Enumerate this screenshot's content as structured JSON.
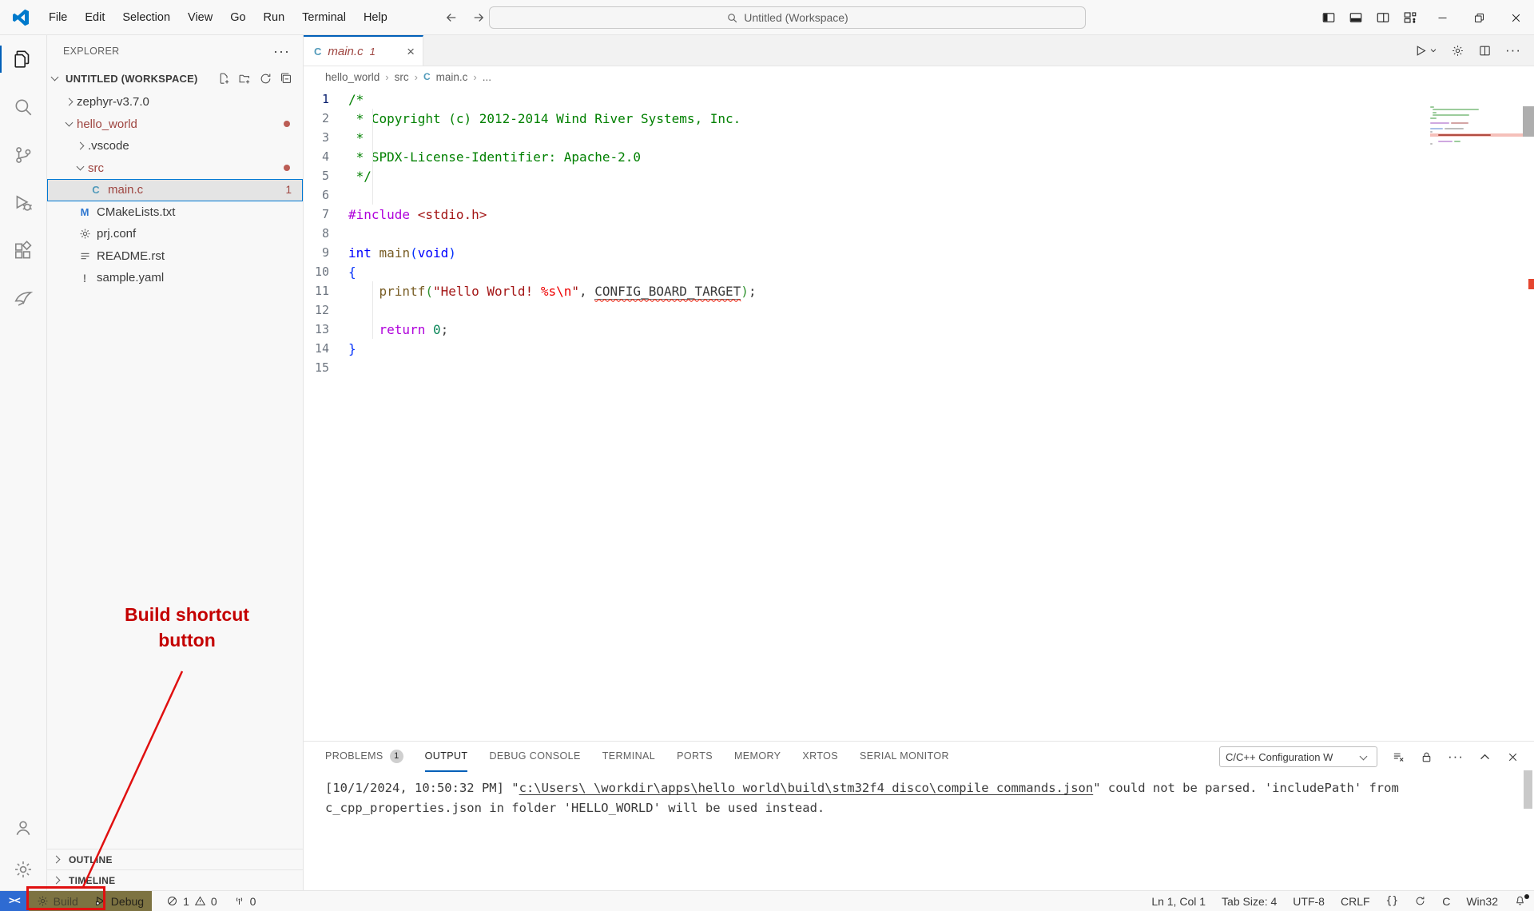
{
  "colors": {
    "accent": "#005fb8",
    "git_modified": "#9e4540",
    "status_olive": "#7d7342",
    "annotation_red": "#c40000",
    "error_red": "#e51400"
  },
  "titlebar": {
    "menus": [
      "File",
      "Edit",
      "Selection",
      "View",
      "Go",
      "Run",
      "Terminal",
      "Help"
    ],
    "search_placeholder": "Untitled (Workspace)"
  },
  "explorer": {
    "header": "EXPLORER",
    "workspace": "UNTITLED (WORKSPACE)",
    "tree": [
      {
        "label": "zephyr-v3.7.0",
        "indent": 0,
        "chevron": "right"
      },
      {
        "label": "hello_world",
        "indent": 0,
        "chevron": "down",
        "modified": true,
        "dot": true
      },
      {
        "label": ".vscode",
        "indent": 1,
        "chevron": "right"
      },
      {
        "label": "src",
        "indent": 1,
        "chevron": "down",
        "modified": true,
        "dot": true
      },
      {
        "label": "main.c",
        "indent": 2,
        "icon": "c",
        "selected": true,
        "modified": true,
        "badge": "1"
      },
      {
        "label": "CMakeLists.txt",
        "indent": 1,
        "icon": "m"
      },
      {
        "label": "prj.conf",
        "indent": 1,
        "icon": "gear"
      },
      {
        "label": "README.rst",
        "indent": 1,
        "icon": "list"
      },
      {
        "label": "sample.yaml",
        "indent": 1,
        "icon": "excl"
      }
    ],
    "sections": [
      "OUTLINE",
      "TIMELINE"
    ]
  },
  "editor": {
    "tab": {
      "label": "main.c",
      "badge": "1"
    },
    "breadcrumb": [
      "hello_world",
      "src",
      "main.c",
      "..."
    ],
    "code": {
      "lines": [
        {
          "n": 1,
          "tokens": [
            [
              "comment",
              "/*"
            ]
          ]
        },
        {
          "n": 2,
          "tokens": [
            [
              "comment",
              " * Copyright (c) 2012-2014 Wind River Systems, Inc."
            ]
          ]
        },
        {
          "n": 3,
          "tokens": [
            [
              "comment",
              " *"
            ]
          ]
        },
        {
          "n": 4,
          "tokens": [
            [
              "comment",
              " * SPDX-License-Identifier: Apache-2.0"
            ]
          ]
        },
        {
          "n": 5,
          "tokens": [
            [
              "comment",
              " */"
            ]
          ]
        },
        {
          "n": 6,
          "tokens": []
        },
        {
          "n": 7,
          "tokens": [
            [
              "preproc",
              "#include"
            ],
            [
              "plain",
              " "
            ],
            [
              "string",
              "<stdio.h>"
            ]
          ]
        },
        {
          "n": 8,
          "tokens": []
        },
        {
          "n": 9,
          "tokens": [
            [
              "keyword",
              "int"
            ],
            [
              "plain",
              " "
            ],
            [
              "func",
              "main"
            ],
            [
              "brace1",
              "("
            ],
            [
              "keyword",
              "void"
            ],
            [
              "brace1",
              ")"
            ]
          ]
        },
        {
          "n": 10,
          "tokens": [
            [
              "brace1",
              "{"
            ]
          ]
        },
        {
          "n": 11,
          "tokens": [
            [
              "plain",
              "    "
            ],
            [
              "func",
              "printf"
            ],
            [
              "brace2",
              "("
            ],
            [
              "string",
              "\"Hello World! "
            ],
            [
              "escape",
              "%s"
            ],
            [
              "escape",
              "\\n"
            ],
            [
              "string",
              "\""
            ],
            [
              "plain",
              ", "
            ],
            [
              "errtoken",
              "CONFIG_BOARD_TARGET"
            ],
            [
              "brace2",
              ")"
            ],
            [
              "plain",
              ";"
            ]
          ]
        },
        {
          "n": 12,
          "tokens": []
        },
        {
          "n": 13,
          "tokens": [
            [
              "plain",
              "    "
            ],
            [
              "preproc",
              "return"
            ],
            [
              "plain",
              " "
            ],
            [
              "number",
              "0"
            ],
            [
              "plain",
              ";"
            ]
          ]
        },
        {
          "n": 14,
          "tokens": [
            [
              "brace1",
              "}"
            ]
          ]
        },
        {
          "n": 15,
          "tokens": []
        }
      ]
    },
    "minimap": [
      {
        "bars": [
          [
            "g",
            5
          ]
        ]
      },
      {
        "bars": [
          [
            "g",
            58
          ]
        ],
        "ind": 3
      },
      {
        "bars": [
          [
            "g",
            5
          ]
        ],
        "ind": 3
      },
      {
        "bars": [
          [
            "g",
            46
          ]
        ],
        "ind": 3
      },
      {
        "bars": [
          [
            "g",
            8
          ]
        ]
      },
      {
        "bars": []
      },
      {
        "bars": [
          [
            "p",
            24
          ],
          [
            "m",
            22
          ]
        ]
      },
      {
        "bars": []
      },
      {
        "bars": [
          [
            "b",
            16
          ],
          [
            "d",
            24
          ]
        ]
      },
      {
        "bars": [
          [
            "d",
            3
          ]
        ]
      },
      {
        "bars": [
          [
            "r",
            66
          ]
        ],
        "ind": 10,
        "band": true
      },
      {
        "bars": []
      },
      {
        "bars": [
          [
            "p",
            18
          ],
          [
            "g",
            8
          ]
        ],
        "ind": 10
      },
      {
        "bars": [
          [
            "d",
            3
          ]
        ]
      },
      {
        "bars": []
      }
    ]
  },
  "panel": {
    "tabs": [
      {
        "label": "PROBLEMS",
        "badge": "1"
      },
      {
        "label": "OUTPUT",
        "active": true
      },
      {
        "label": "DEBUG CONSOLE"
      },
      {
        "label": "TERMINAL"
      },
      {
        "label": "PORTS"
      },
      {
        "label": "MEMORY"
      },
      {
        "label": "XRTOS"
      },
      {
        "label": "SERIAL MONITOR"
      }
    ],
    "dropdown": "C/C++ Configuration W",
    "output_lines": [
      {
        "segments": [
          {
            "text": "[10/1/2024, 10:50:32 PM] \"",
            "link": false
          },
          {
            "text": "c:\\Users\\        \\workdir\\apps\\hello_world\\build\\stm32f4_disco\\compile_commands.json",
            "link": true
          },
          {
            "text": "\" could not be parsed. 'includePath' from",
            "link": false
          }
        ]
      },
      {
        "segments": [
          {
            "text": "c_cpp_properties.json in folder 'HELLO_WORLD' will be used instead.",
            "link": false
          }
        ]
      }
    ]
  },
  "status_bar": {
    "build_label": "Build",
    "debug_label": "Debug",
    "errors": "1",
    "warnings": "0",
    "ports": "0",
    "line_col": "Ln 1, Col 1",
    "tab_size": "Tab Size: 4",
    "encoding": "UTF-8",
    "eol": "CRLF",
    "braces": "{}",
    "language": "C",
    "platform": "Win32"
  },
  "annotation": {
    "line1": "Build shortcut",
    "line2": "button"
  }
}
